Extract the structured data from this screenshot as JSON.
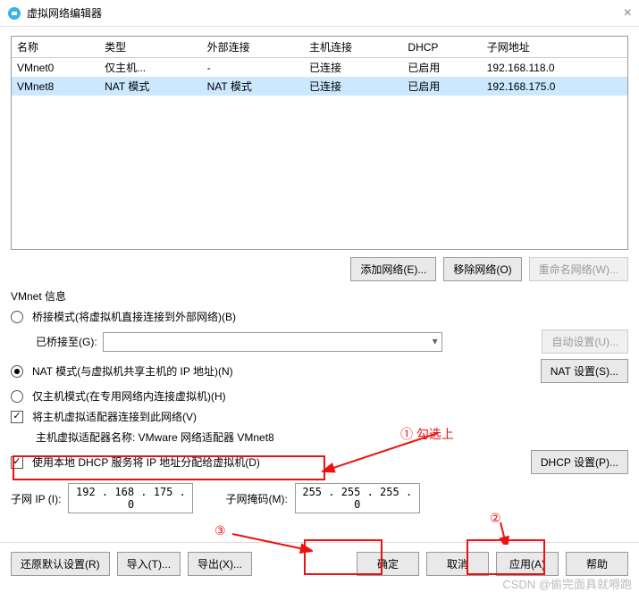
{
  "title": "虚拟网络编辑器",
  "table": {
    "headers": [
      "名称",
      "类型",
      "外部连接",
      "主机连接",
      "DHCP",
      "子网地址"
    ],
    "rows": [
      [
        "VMnet0",
        "仅主机...",
        "-",
        "已连接",
        "已启用",
        "192.168.118.0"
      ],
      [
        "VMnet8",
        "NAT 模式",
        "NAT 模式",
        "已连接",
        "已启用",
        "192.168.175.0"
      ]
    ]
  },
  "netbtns": {
    "add": "添加网络(E)...",
    "remove": "移除网络(O)",
    "rename": "重命名网络(W)..."
  },
  "info_title": "VMnet 信息",
  "radio1": "桥接模式(将虚拟机直接连接到外部网络)(B)",
  "bridge_label": "已桥接至(G):",
  "auto_btn": "自动设置(U)...",
  "radio2": "NAT 模式(与虚拟机共享主机的 IP 地址)(N)",
  "nat_btn": "NAT 设置(S)...",
  "radio3": "仅主机模式(在专用网络内连接虚拟机)(H)",
  "check1": "将主机虚拟适配器连接到此网络(V)",
  "adapter_label": "主机虚拟适配器名称: VMware 网络适配器 VMnet8",
  "check2": "使用本地 DHCP 服务将 IP 地址分配给虚拟机(D)",
  "dhcp_btn": "DHCP 设置(P)...",
  "subnet_ip_label": "子网 IP (I):",
  "subnet_ip": "192 . 168 . 175 .  0",
  "subnet_mask_label": "子网掩码(M):",
  "subnet_mask": "255 . 255 . 255 .  0",
  "footer": {
    "restore": "还原默认设置(R)",
    "import": "导入(T)...",
    "export": "导出(X)...",
    "ok": "确定",
    "cancel": "取消",
    "apply": "应用(A)",
    "help": "帮助"
  },
  "anno": {
    "a1": "① 勾选上",
    "a2": "②",
    "a3": "③"
  },
  "watermark": "CSDN @偷完面具就嘚跑"
}
